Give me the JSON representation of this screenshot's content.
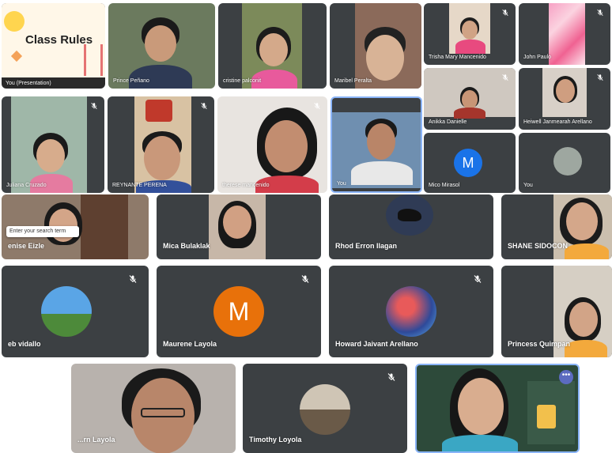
{
  "presentation": {
    "title": "Class Rules",
    "label": "You (Presentation)"
  },
  "participants": [
    {
      "name": "Prince Peñano"
    },
    {
      "name": "cristine palconit"
    },
    {
      "name": "Maribel Peralta"
    },
    {
      "name": "Trisha Mary Mancenido"
    },
    {
      "name": "John Paulo"
    },
    {
      "name": "Juliana Cruzado"
    },
    {
      "name": "REYNANTE PERENA"
    },
    {
      "name": "therese mancenido"
    },
    {
      "name": "You"
    },
    {
      "name": "Anikka Danielle"
    },
    {
      "name": "Heiwell Janmearah Arellano"
    },
    {
      "name": "Mico Mirasol",
      "initial": "M"
    },
    {
      "name": "You"
    },
    {
      "name": "enise Eizle"
    },
    {
      "name": "Mica Bulaklak"
    },
    {
      "name": "Rhod Erron Ilagan"
    },
    {
      "name": "SHANE SIDOCON"
    },
    {
      "name": "eb vidallo"
    },
    {
      "name": "Maurene Layola",
      "initial": "M"
    },
    {
      "name": "Howard Jaivant Arellano"
    },
    {
      "name": "Princess Quimpan"
    },
    {
      "name": "...rn Layola"
    },
    {
      "name": "Timothy Loyola"
    },
    {
      "name": ""
    }
  ],
  "search": {
    "placeholder": "Enter your search term"
  },
  "more_options": "•••",
  "colors": {
    "tile_bg": "#3c4043",
    "avatar_blue": "#1a73e8",
    "avatar_orange": "#e8710a",
    "active_border": "#8ab4f8"
  }
}
